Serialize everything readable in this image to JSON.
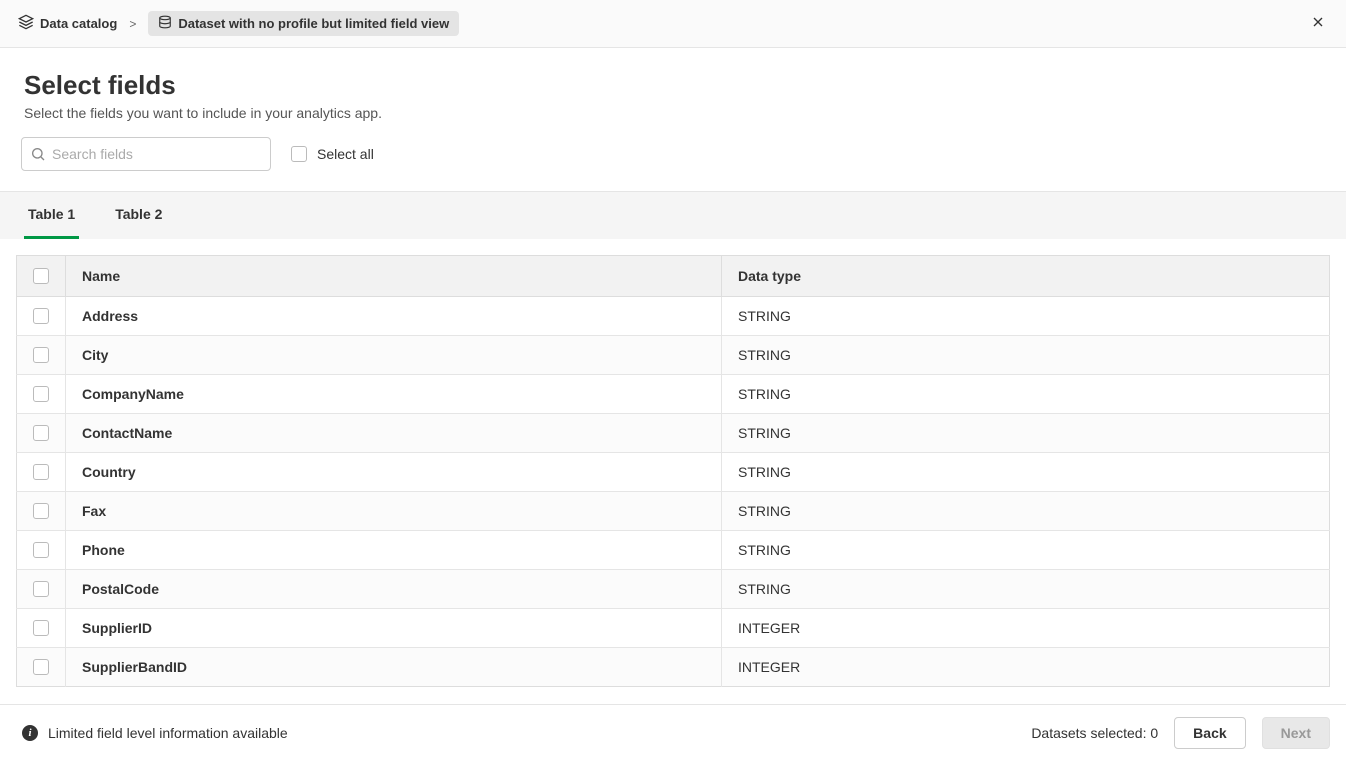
{
  "breadcrumb": {
    "root_label": "Data catalog",
    "separator": ">",
    "dataset_label": "Dataset with no profile but limited field view"
  },
  "header": {
    "title": "Select fields",
    "subtitle": "Select the fields you want to include in your analytics app."
  },
  "controls": {
    "search_placeholder": "Search fields",
    "select_all_label": "Select all"
  },
  "tabs": [
    {
      "label": "Table 1",
      "active": true
    },
    {
      "label": "Table 2",
      "active": false
    }
  ],
  "table": {
    "columns": {
      "name": "Name",
      "type": "Data type"
    },
    "rows": [
      {
        "name": "Address",
        "type": "STRING"
      },
      {
        "name": "City",
        "type": "STRING"
      },
      {
        "name": "CompanyName",
        "type": "STRING"
      },
      {
        "name": "ContactName",
        "type": "STRING"
      },
      {
        "name": "Country",
        "type": "STRING"
      },
      {
        "name": "Fax",
        "type": "STRING"
      },
      {
        "name": "Phone",
        "type": "STRING"
      },
      {
        "name": "PostalCode",
        "type": "STRING"
      },
      {
        "name": "SupplierID",
        "type": "INTEGER"
      },
      {
        "name": "SupplierBandID",
        "type": "INTEGER"
      }
    ]
  },
  "footer": {
    "info_text": "Limited field level information available",
    "datasets_selected_label": "Datasets selected: 0",
    "back_label": "Back",
    "next_label": "Next"
  }
}
